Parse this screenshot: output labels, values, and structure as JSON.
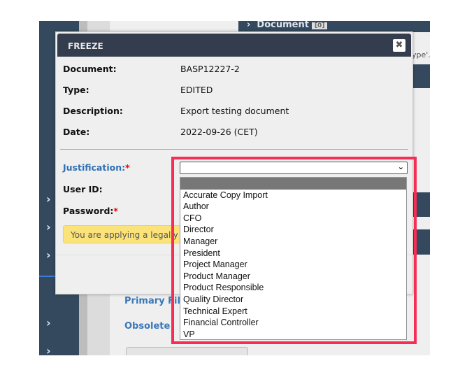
{
  "background": {
    "document_tab": "Document",
    "document_count": "[0]",
    "partial_text": "ype'.",
    "primary_file_link": "Primary File",
    "obsolete_link": "Obsolete"
  },
  "modal": {
    "title": "FREEZE",
    "close_icon": "close-icon",
    "fields": [
      {
        "label": "Document:",
        "value": "BASP12227-2"
      },
      {
        "label": "Type:",
        "value": "EDITED"
      },
      {
        "label": "Description:",
        "value": "Export testing document"
      },
      {
        "label": "Date:",
        "value": "2022-09-26 (CET)"
      }
    ],
    "justification_label": "Justification:",
    "user_id_label": "User ID:",
    "password_label": "Password:",
    "required_mark": "*",
    "warning": "You are applying a legally bi",
    "justification_select": {
      "value": "",
      "options": [
        "",
        "Accurate Copy Import",
        "Author",
        "CFO",
        "Director",
        "Manager",
        "President",
        "Project Manager",
        "Product Manager",
        "Product Responsible",
        "Quality Director",
        "Technical Expert",
        "Financial Controller",
        "VP"
      ]
    }
  },
  "colors": {
    "highlight": "#f72d55",
    "header": "#343d4e",
    "sidebar": "#34495e",
    "link": "#2f6fb3"
  }
}
